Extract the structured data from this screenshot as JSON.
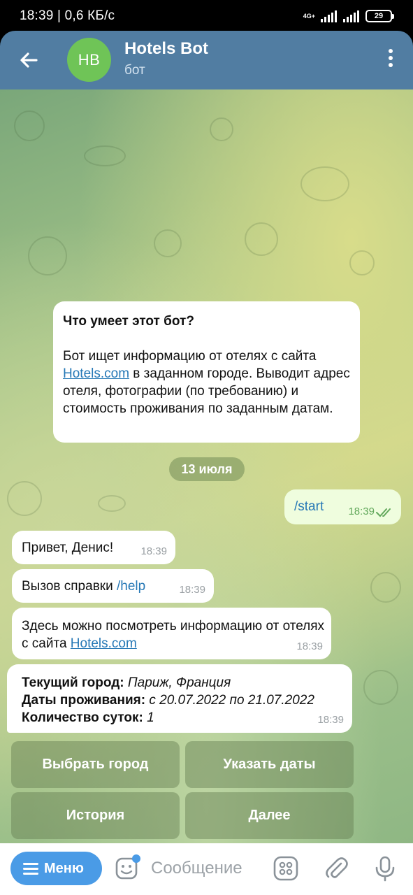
{
  "status": {
    "time": "18:39 | 0,6 КБ/с",
    "battery": "29",
    "network": "4G+"
  },
  "header": {
    "avatar_initials": "HB",
    "title": "Hotels Bot",
    "subtitle": "бот"
  },
  "info_card": {
    "title": "Что умеет этот бот?",
    "text_before": "Бот ищет информацию от отелях с сайта ",
    "link": "Hotels.com",
    "text_after": " в заданном городе. Выводит адрес отеля, фотографии (по требованию) и стоимость проживания по заданным датам."
  },
  "date_separator": "13 июля",
  "messages": {
    "start": {
      "text": "/start",
      "time": "18:39"
    },
    "greeting": {
      "text": "Привет, Денис!",
      "time": "18:39"
    },
    "help": {
      "prefix": "Вызов справки ",
      "command": "/help",
      "time": "18:39"
    },
    "about": {
      "text": "Здесь можно посмотреть информацию от отелях с сайта ",
      "link": "Hotels.com",
      "time": "18:39"
    },
    "summary": {
      "city_label": "Текущий город:",
      "city_value": " Париж, Франция",
      "dates_label": "Даты проживания:",
      "dates_value": " с 20.07.2022 по 21.07.2022",
      "nights_label": "Количество суток:",
      "nights_value": " 1",
      "time": "18:39"
    }
  },
  "keyboard": {
    "choose_city": "Выбрать город",
    "set_dates": "Указать даты",
    "history": "История",
    "next": "Далее"
  },
  "input_bar": {
    "menu_label": "Меню",
    "placeholder": "Сообщение"
  },
  "colors": {
    "header": "#517da2",
    "accent": "#4a9be6",
    "avatar": "#6fc457",
    "link": "#2678b6",
    "outgoing": "#effdde"
  }
}
